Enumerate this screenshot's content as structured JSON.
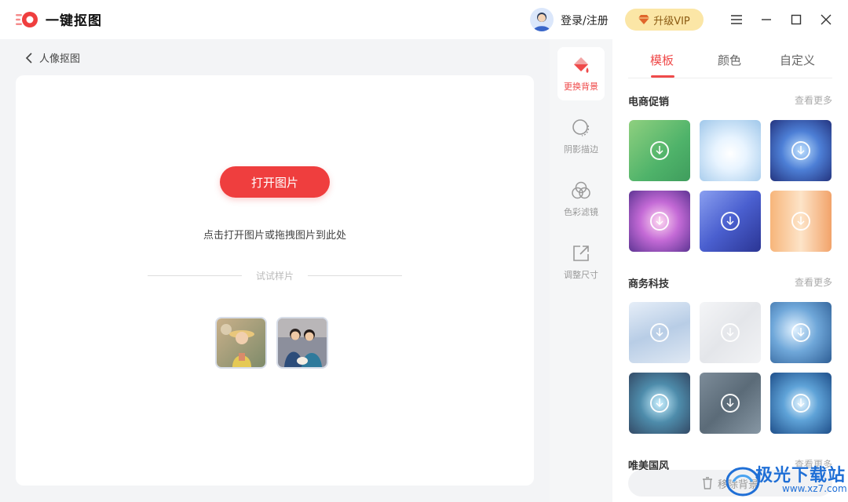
{
  "app": {
    "title": "一键抠图"
  },
  "header": {
    "login_label": "登录/注册",
    "vip_label": "升级VIP"
  },
  "nav": {
    "back_label": "人像抠图"
  },
  "main": {
    "open_button": "打开图片",
    "hint": "点击打开图片或拖拽图片到此处",
    "sample_label": "试试样片"
  },
  "tools": [
    {
      "label": "更换背景",
      "icon": "paint-bucket-icon"
    },
    {
      "label": "阴影描边",
      "icon": "shadow-outline-icon"
    },
    {
      "label": "色彩滤镜",
      "icon": "color-filter-icon"
    },
    {
      "label": "调整尺寸",
      "icon": "resize-icon"
    }
  ],
  "panel": {
    "tabs": [
      "模板",
      "颜色",
      "自定义"
    ],
    "active_tab": "模板",
    "more_label": "查看更多",
    "sections": [
      {
        "title": "电商促销"
      },
      {
        "title": "商务科技"
      },
      {
        "title": "唯美国风"
      }
    ],
    "bottom_label": "移除背景"
  },
  "watermark": {
    "text": "极光下载站",
    "url": "www.xz7.com"
  },
  "colors": {
    "accent": "#ef3e3e",
    "vip_bg": "#fbe6a6",
    "panel_bg": "#ffffff",
    "app_bg": "#f3f4f6"
  }
}
